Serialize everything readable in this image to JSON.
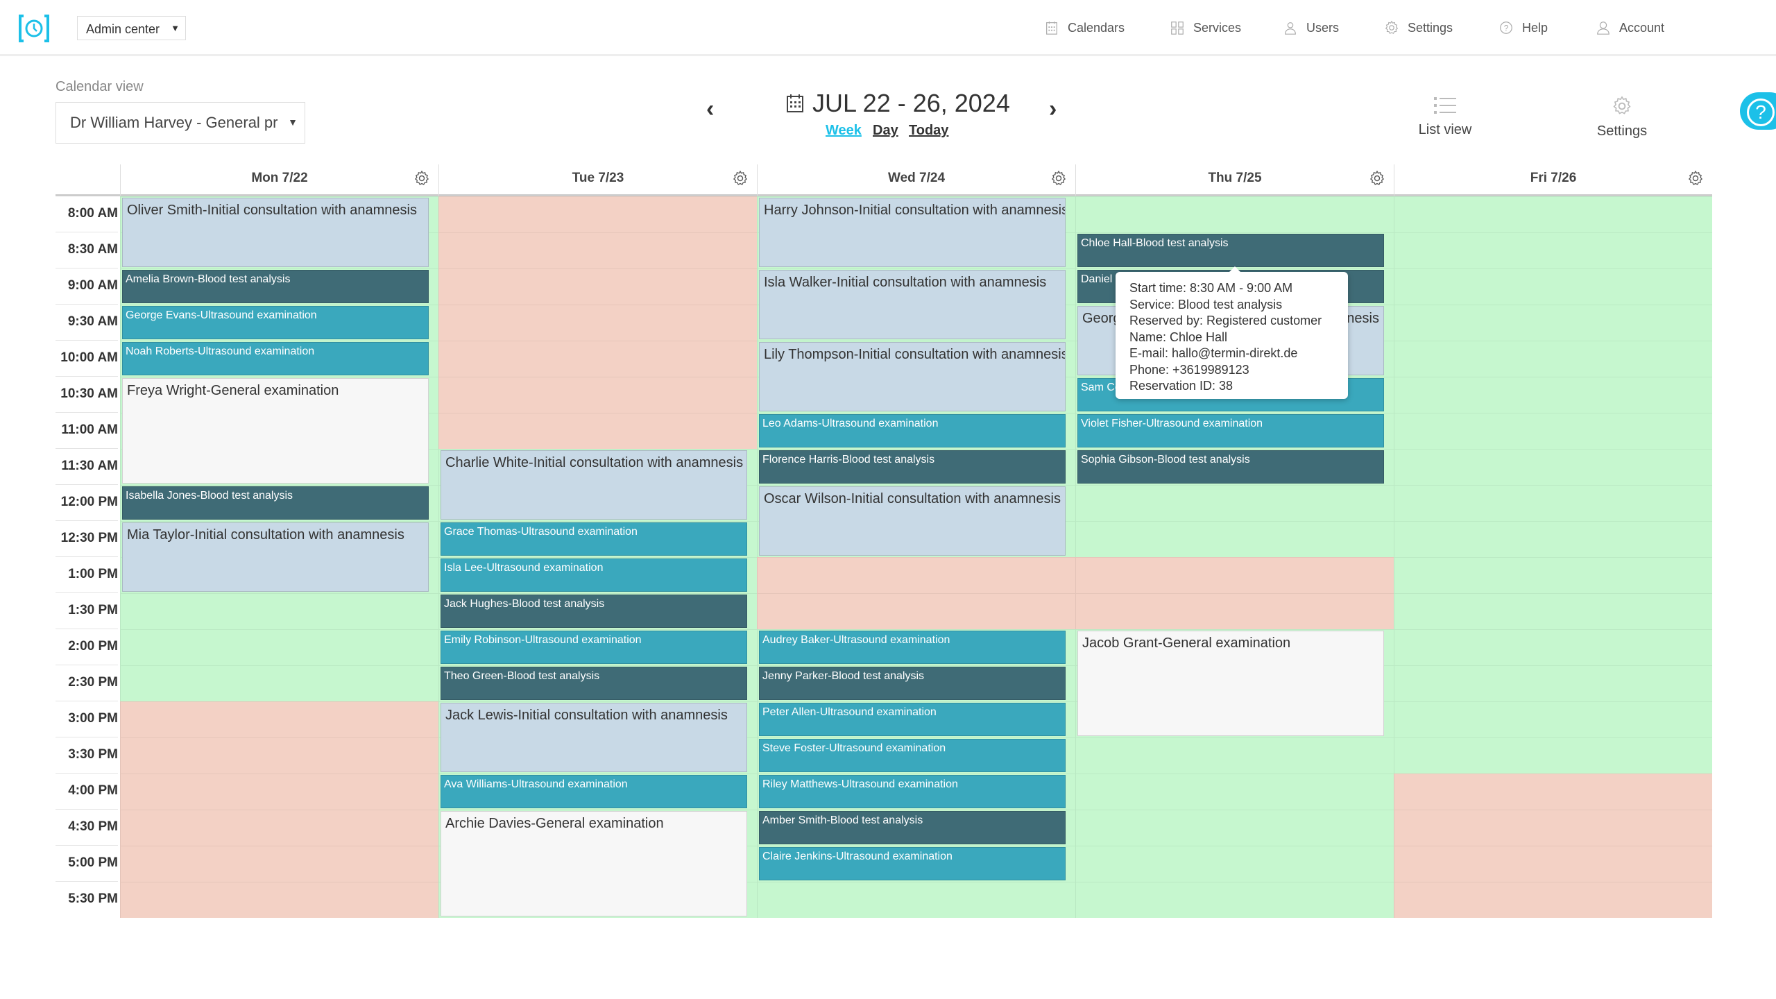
{
  "header": {
    "admin_menu": "Admin center",
    "nav": [
      {
        "label": "Calendars",
        "icon": "calendar-icon"
      },
      {
        "label": "Services",
        "icon": "grid-icon"
      },
      {
        "label": "Users",
        "icon": "users-icon"
      },
      {
        "label": "Settings",
        "icon": "gear-icon"
      },
      {
        "label": "Help",
        "icon": "help-icon"
      },
      {
        "label": "Account",
        "icon": "account-icon"
      }
    ]
  },
  "toolbar": {
    "calendar_view_label": "Calendar view",
    "calendar_selected": "Dr William Harvey - General pr",
    "date_range": "JUL 22 - 26, 2024",
    "views": [
      "Week",
      "Day",
      "Today"
    ],
    "active_view": "Week",
    "list_view": "List view",
    "settings": "Settings"
  },
  "colors": {
    "accent": "#1cc0e8",
    "available": "#c6f7cf",
    "unavailable": "#f3d1c5",
    "initial": "#c8d9e6",
    "general": "#f7f7f7",
    "blood": "#3f6b76",
    "ultrasound": "#3aa8bd"
  },
  "times": [
    "8:00 AM",
    "8:30 AM",
    "9:00 AM",
    "9:30 AM",
    "10:00 AM",
    "10:30 AM",
    "11:00 AM",
    "11:30 AM",
    "12:00 PM",
    "12:30 PM",
    "1:00 PM",
    "1:30 PM",
    "2:00 PM",
    "2:30 PM",
    "3:00 PM",
    "3:30 PM",
    "4:00 PM",
    "4:30 PM",
    "5:00 PM",
    "5:30 PM"
  ],
  "days": [
    {
      "label": "Mon 7/22",
      "unavailable": [
        [
          "3:00 PM",
          "6:00 PM"
        ]
      ],
      "events": [
        {
          "title": "Oliver Smith-Initial consultation with anamnesis",
          "type": "initial",
          "start": "8:00 AM",
          "end": "9:00 AM"
        },
        {
          "title": "Amelia Brown-Blood test analysis",
          "type": "blood",
          "start": "9:00 AM",
          "end": "9:30 AM"
        },
        {
          "title": "George Evans-Ultrasound examination",
          "type": "ultrasound",
          "start": "9:30 AM",
          "end": "10:00 AM"
        },
        {
          "title": "Noah Roberts-Ultrasound examination",
          "type": "ultrasound",
          "start": "10:00 AM",
          "end": "10:30 AM"
        },
        {
          "title": "Freya Wright-General examination",
          "type": "general",
          "start": "10:30 AM",
          "end": "12:00 PM"
        },
        {
          "title": "Isabella Jones-Blood test analysis",
          "type": "blood",
          "start": "12:00 PM",
          "end": "12:30 PM"
        },
        {
          "title": "Mia Taylor-Initial consultation with anamnesis",
          "type": "initial",
          "start": "12:30 PM",
          "end": "1:30 PM"
        }
      ]
    },
    {
      "label": "Tue 7/23",
      "unavailable": [
        [
          "8:00 AM",
          "11:30 AM"
        ]
      ],
      "events": [
        {
          "title": "Charlie White-Initial consultation with anamnesis",
          "type": "initial",
          "start": "11:30 AM",
          "end": "12:30 PM"
        },
        {
          "title": "Grace Thomas-Ultrasound examination",
          "type": "ultrasound",
          "start": "12:30 PM",
          "end": "1:00 PM"
        },
        {
          "title": "Isla Lee-Ultrasound examination",
          "type": "ultrasound",
          "start": "1:00 PM",
          "end": "1:30 PM"
        },
        {
          "title": "Jack Hughes-Blood test analysis",
          "type": "blood",
          "start": "1:30 PM",
          "end": "2:00 PM"
        },
        {
          "title": "Emily Robinson-Ultrasound examination",
          "type": "ultrasound",
          "start": "2:00 PM",
          "end": "2:30 PM"
        },
        {
          "title": "Theo Green-Blood test analysis",
          "type": "blood",
          "start": "2:30 PM",
          "end": "3:00 PM"
        },
        {
          "title": "Jack Lewis-Initial consultation with anamnesis",
          "type": "initial",
          "start": "3:00 PM",
          "end": "4:00 PM"
        },
        {
          "title": "Ava Williams-Ultrasound examination",
          "type": "ultrasound",
          "start": "4:00 PM",
          "end": "4:30 PM"
        },
        {
          "title": "Archie Davies-General examination",
          "type": "general",
          "start": "4:30 PM",
          "end": "6:00 PM"
        }
      ]
    },
    {
      "label": "Wed 7/24",
      "unavailable": [
        [
          "1:00 PM",
          "2:00 PM"
        ]
      ],
      "events": [
        {
          "title": "Harry Johnson-Initial consultation with anamnesis",
          "type": "initial",
          "start": "8:00 AM",
          "end": "9:00 AM"
        },
        {
          "title": "Isla Walker-Initial consultation with anamnesis",
          "type": "initial",
          "start": "9:00 AM",
          "end": "10:00 AM"
        },
        {
          "title": "Lily Thompson-Initial consultation with anamnesis",
          "type": "initial",
          "start": "10:00 AM",
          "end": "11:00 AM"
        },
        {
          "title": "Leo Adams-Ultrasound examination",
          "type": "ultrasound",
          "start": "11:00 AM",
          "end": "11:30 AM"
        },
        {
          "title": "Florence Harris-Blood test analysis",
          "type": "blood",
          "start": "11:30 AM",
          "end": "12:00 PM"
        },
        {
          "title": "Oscar Wilson-Initial consultation with anamnesis",
          "type": "initial",
          "start": "12:00 PM",
          "end": "1:00 PM"
        },
        {
          "title": "Audrey Baker-Ultrasound examination",
          "type": "ultrasound",
          "start": "2:00 PM",
          "end": "2:30 PM"
        },
        {
          "title": "Jenny Parker-Blood test analysis",
          "type": "blood",
          "start": "2:30 PM",
          "end": "3:00 PM"
        },
        {
          "title": "Peter Allen-Ultrasound examination",
          "type": "ultrasound",
          "start": "3:00 PM",
          "end": "3:30 PM"
        },
        {
          "title": "Steve Foster-Ultrasound examination",
          "type": "ultrasound",
          "start": "3:30 PM",
          "end": "4:00 PM"
        },
        {
          "title": "Riley Matthews-Ultrasound examination",
          "type": "ultrasound",
          "start": "4:00 PM",
          "end": "4:30 PM"
        },
        {
          "title": "Amber Smith-Blood test analysis",
          "type": "blood",
          "start": "4:30 PM",
          "end": "5:00 PM"
        },
        {
          "title": "Claire Jenkins-Ultrasound examination",
          "type": "ultrasound",
          "start": "5:00 PM",
          "end": "5:30 PM"
        }
      ]
    },
    {
      "label": "Thu 7/25",
      "unavailable": [
        [
          "1:00 PM",
          "2:00 PM"
        ]
      ],
      "events": [
        {
          "title": "Chloe Hall-Blood test analysis",
          "type": "blood",
          "start": "8:30 AM",
          "end": "9:00 AM"
        },
        {
          "title": "Daniel",
          "type": "blood",
          "start": "9:00 AM",
          "end": "9:30 AM"
        },
        {
          "title": "Georg",
          "tail": "nesis",
          "type": "initial",
          "start": "9:30 AM",
          "end": "10:30 AM"
        },
        {
          "title": "Sam Co",
          "type": "ultrasound",
          "start": "10:30 AM",
          "end": "11:00 AM"
        },
        {
          "title": "Violet Fisher-Ultrasound examination",
          "type": "ultrasound",
          "start": "11:00 AM",
          "end": "11:30 AM"
        },
        {
          "title": "Sophia Gibson-Blood test analysis",
          "type": "blood",
          "start": "11:30 AM",
          "end": "12:00 PM"
        },
        {
          "title": "Jacob Grant-General examination",
          "type": "general",
          "start": "2:00 PM",
          "end": "3:30 PM"
        }
      ]
    },
    {
      "label": "Fri 7/26",
      "unavailable": [
        [
          "4:00 PM",
          "6:00 PM"
        ]
      ],
      "events": []
    }
  ],
  "tooltip": {
    "lines": [
      "Start time: 8:30 AM - 9:00 AM",
      "Service: Blood test analysis",
      "Reserved by: Registered customer",
      "Name: Chloe Hall",
      "E-mail: hallo@termin-direkt.de",
      "Phone: +3619989123",
      "Reservation ID: 38"
    ]
  }
}
